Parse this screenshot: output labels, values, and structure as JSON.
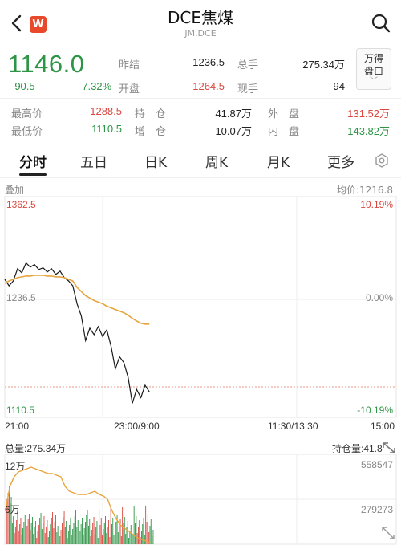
{
  "header": {
    "title": "DCE焦煤",
    "subtitle": "JM.DCE",
    "logo_letter": "W"
  },
  "quote": {
    "last_price": "1146.0",
    "change": "-90.5",
    "change_pct": "-7.32%",
    "prev_settle_label": "昨结",
    "prev_settle": "1236.5",
    "total_volume_label": "总手",
    "total_volume": "275.34万",
    "open_label": "开盘",
    "open": "1264.5",
    "current_volume_label": "现手",
    "current_volume": "94",
    "wind_button_line1": "万得",
    "wind_button_line2": "盘口"
  },
  "stats": {
    "high_label": "最高价",
    "high": "1288.5",
    "position_label": "持　仓",
    "position": "41.87万",
    "outer_label": "外　盘",
    "outer": "131.52万",
    "low_label": "最低价",
    "low": "1110.5",
    "position_chg_label": "增　仓",
    "position_chg": "-10.07万",
    "inner_label": "内　盘",
    "inner": "143.82万"
  },
  "tabs": [
    "分时",
    "五日",
    "日K",
    "周K",
    "月K",
    "更多"
  ],
  "chart_labels": {
    "overlay": "叠加",
    "avg_price": "均价:1216.8",
    "y_top": "1362.5",
    "y_mid": "1236.5",
    "y_bottom": "1110.5",
    "pct_top": "10.19%",
    "pct_mid": "0.00%",
    "pct_bottom": "-10.19%",
    "x_ticks": [
      "21:00",
      "23:00/9:00",
      "11:30/13:30",
      "15:00"
    ]
  },
  "volume_labels": {
    "total": "总量:275.34万",
    "position": "持仓量:41.8",
    "y_top_left": "12万",
    "y_mid_left": "6万",
    "y_top_right": "558547",
    "y_mid_right": "279273"
  },
  "colors": {
    "up": "#d9473e",
    "down": "#2e9547",
    "avg_line": "#e8a43c",
    "price_line": "#1a1a1a"
  },
  "chart_data": {
    "type": "line",
    "ylim": [
      1110.5,
      1362.5
    ],
    "series": [
      {
        "values": [
          1270,
          1262,
          1268,
          1283,
          1278,
          1290,
          1285,
          1288,
          1282,
          1284,
          1279,
          1283,
          1276,
          1280,
          1272,
          1268,
          1262,
          1240,
          1225,
          1195,
          1210,
          1202,
          1212,
          1200,
          1208,
          1188,
          1160,
          1175,
          1168,
          1150,
          1118,
          1135,
          1125,
          1140,
          1132
        ]
      },
      {
        "values": [
          1265,
          1268,
          1270,
          1272,
          1273,
          1274,
          1274,
          1275,
          1275,
          1275,
          1274,
          1274,
          1273,
          1273,
          1272,
          1270,
          1268,
          1260,
          1255,
          1250,
          1247,
          1244,
          1242,
          1240,
          1237,
          1235,
          1233,
          1231,
          1229,
          1226,
          1222,
          1219,
          1216,
          1215,
          1215
        ]
      }
    ]
  }
}
